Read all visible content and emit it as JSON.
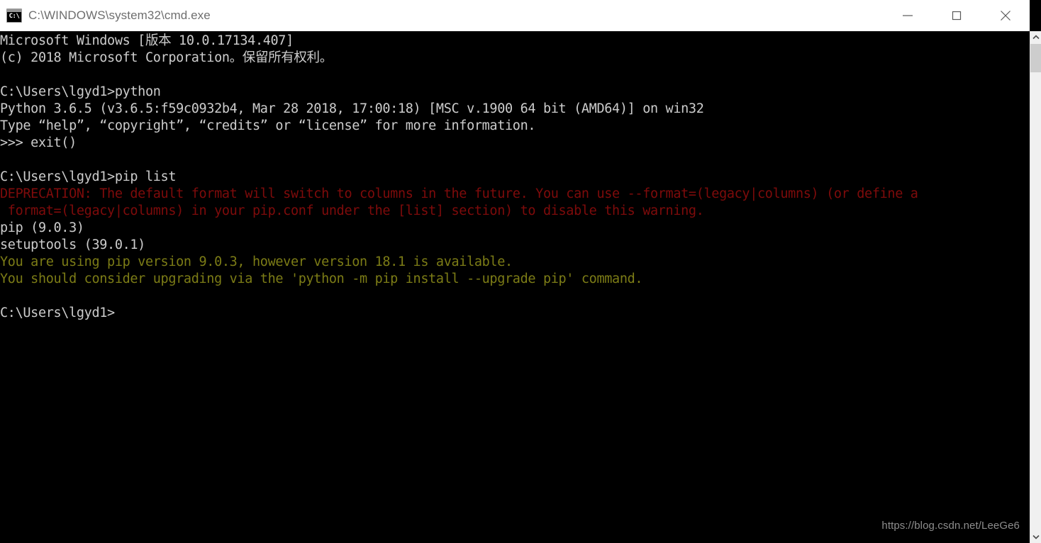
{
  "window": {
    "title": "C:\\WINDOWS\\system32\\cmd.exe",
    "icon_glyph": "C:\\",
    "background_color": "#000000",
    "titlebar_color": "#ffffff",
    "title_text_color": "#6e6e6e"
  },
  "titlebar_buttons": {
    "minimize_label": "Minimize",
    "maximize_label": "Maximize",
    "close_label": "Close"
  },
  "colors": {
    "default_text": "#cccccc",
    "error_text": "#7e0b0b",
    "warning_text": "#7c7c16"
  },
  "terminal": {
    "lines": [
      {
        "text": "Microsoft Windows [版本 10.0.17134.407]",
        "color": "white"
      },
      {
        "text": "(c) 2018 Microsoft Corporation。保留所有权利。",
        "color": "white"
      },
      {
        "text": "",
        "color": "white"
      },
      {
        "text": "C:\\Users\\lgyd1>python",
        "color": "white"
      },
      {
        "text": "Python 3.6.5 (v3.6.5:f59c0932b4, Mar 28 2018, 17:00:18) [MSC v.1900 64 bit (AMD64)] on win32",
        "color": "white"
      },
      {
        "text": "Type “help”, “copyright”, “credits” or “license” for more information.",
        "color": "white"
      },
      {
        "text": ">>> exit()",
        "color": "white"
      },
      {
        "text": "",
        "color": "white"
      },
      {
        "text": "C:\\Users\\lgyd1>pip list",
        "color": "white"
      },
      {
        "text": "DEPRECATION: The default format will switch to columns in the future. You can use --format=(legacy|columns) (or define a",
        "color": "red"
      },
      {
        "text": " format=(legacy|columns) in your pip.conf under the [list] section) to disable this warning.",
        "color": "red"
      },
      {
        "text": "pip (9.0.3)",
        "color": "white"
      },
      {
        "text": "setuptools (39.0.1)",
        "color": "white"
      },
      {
        "text": "You are using pip version 9.0.3, however version 18.1 is available.",
        "color": "yellow"
      },
      {
        "text": "You should consider upgrading via the 'python -m pip install --upgrade pip' command.",
        "color": "yellow"
      },
      {
        "text": "",
        "color": "white"
      },
      {
        "text": "C:\\Users\\lgyd1>",
        "color": "white"
      }
    ]
  },
  "scrollbar": {
    "up_arrow_label": "Scroll up",
    "down_arrow_label": "Scroll down",
    "thumb_label": "Scroll thumb"
  },
  "watermark": {
    "text": "https://blog.csdn.net/LeeGe6"
  }
}
